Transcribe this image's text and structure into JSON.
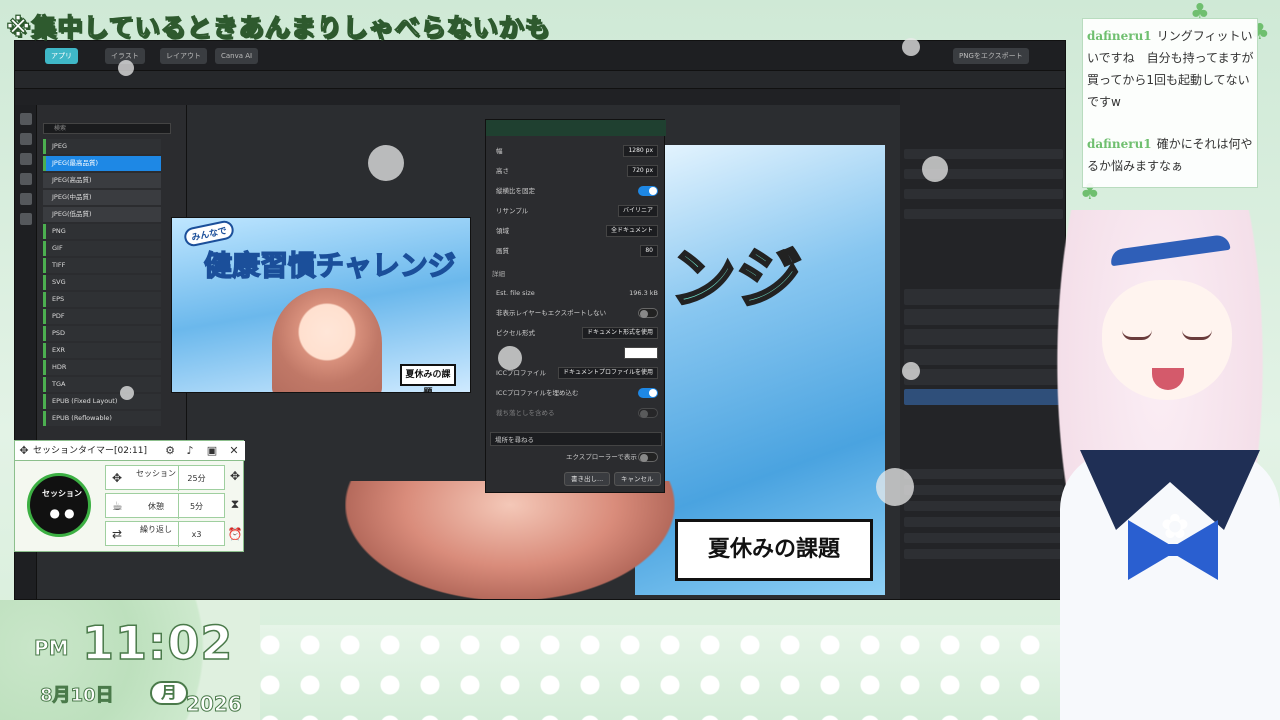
{
  "banner": {
    "text": "※集中しているときあんまりしゃべらないかも"
  },
  "app": {
    "toolbar_buttons": [
      "アプリ",
      "イラスト",
      "レイアウト",
      "Canva AI"
    ],
    "right_button": "PNGをエクスポート"
  },
  "export_dialog": {
    "search_placeholder": "検索",
    "formats": [
      {
        "label": "JPEG",
        "style": "normal"
      },
      {
        "label": "JPEG(最高品質)",
        "style": "selected"
      },
      {
        "label": "JPEG(高品質)",
        "style": "sub"
      },
      {
        "label": "JPEG(中品質)",
        "style": "sub"
      },
      {
        "label": "JPEG(低品質)",
        "style": "sub"
      },
      {
        "label": "PNG",
        "style": "normal"
      },
      {
        "label": "GIF",
        "style": "normal"
      },
      {
        "label": "TIFF",
        "style": "normal"
      },
      {
        "label": "SVG",
        "style": "normal"
      },
      {
        "label": "EPS",
        "style": "normal"
      },
      {
        "label": "PDF",
        "style": "normal"
      },
      {
        "label": "PSD",
        "style": "normal"
      },
      {
        "label": "EXR",
        "style": "normal"
      },
      {
        "label": "HDR",
        "style": "normal"
      },
      {
        "label": "TGA",
        "style": "normal"
      },
      {
        "label": "EPUB (Fixed Layout)",
        "style": "normal"
      },
      {
        "label": "EPUB (Reflowable)",
        "style": "normal"
      }
    ],
    "preview": {
      "tag": "みんなで",
      "title": "健康習慣チャレンジ",
      "badge": "夏休みの課題"
    },
    "props": {
      "width_label": "幅",
      "width_value": "1280 px",
      "height_label": "高さ",
      "height_value": "720 px",
      "aspect_label": "縦横比を固定",
      "aspect_on": true,
      "resample_label": "リサンプル",
      "resample_value": "バイリニア",
      "area_label": "領域",
      "area_value": "全ドキュメント",
      "quality_label": "画質",
      "quality_value": "80",
      "details_heading": "詳細",
      "filesize_label": "Est. file size",
      "filesize_value": "196.3 kB",
      "hidden_layers_label": "非表示レイヤーもエクスポートしない",
      "hidden_layers_on": false,
      "pixel_format_label": "ピクセル形式",
      "pixel_format_value": "ドキュメント形式を使用",
      "icc_label": "ICCプロファイル",
      "icc_value": "ドキュメントプロファイルを使用",
      "embed_icc_label": "ICCプロファイルを埋め込む",
      "embed_icc_on": true,
      "bleed_label": "裁ち落としを含める",
      "bleed_on": false,
      "location_label": "場所を尋ねる",
      "explorer_label": "エクスプローラーで表示",
      "explorer_on": false,
      "export_button": "書き出し...",
      "cancel_button": "キャンセル"
    }
  },
  "canvas": {
    "title": "ンジ",
    "badge": "夏休みの課題"
  },
  "chat": [
    {
      "user": "dafineru1",
      "message": "リングフィットいいですね　自分も持ってますが買ってから1回も起動してないですw"
    },
    {
      "user": "dafineru1",
      "message": "確かにそれは何やるか悩みますなぁ"
    }
  ],
  "session_timer": {
    "title": "セッションタイマー",
    "elapsed": "[02:11]",
    "circle_label": "セッション",
    "rows": [
      {
        "icon": "session-icon",
        "label": "セッション",
        "value": "25分"
      },
      {
        "icon": "coffee-icon",
        "label": "休憩",
        "value": "5分"
      },
      {
        "icon": "repeat-icon",
        "label": "繰り返し",
        "value": "x3"
      }
    ]
  },
  "clock": {
    "ampm": "PM",
    "time": "11:02",
    "date": "8月10日",
    "weekday": "月",
    "year": "2026"
  }
}
